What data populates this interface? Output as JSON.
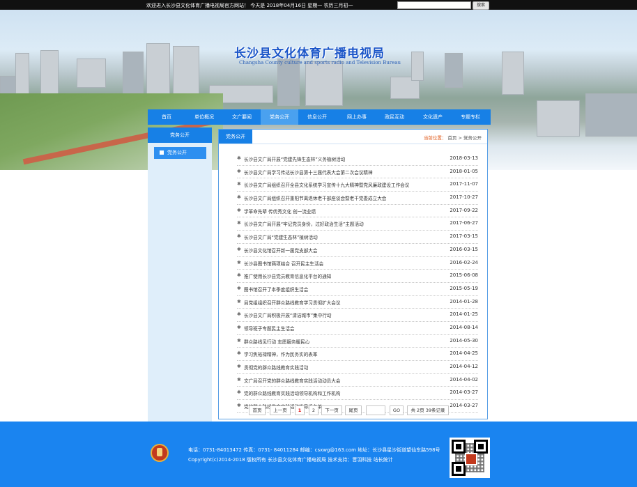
{
  "topbar": {
    "welcome": "欢迎进入长沙县文化体育广播电视局官方网站！ 今天是 2018年04月16日 星期一 农历三月初一",
    "search_value": "",
    "search_button": "搜索"
  },
  "banner": {
    "title": "长沙县文化体育广播电视局",
    "subtitle": "Changsha County culture and sports radio and Television Bureau"
  },
  "nav": [
    {
      "label": "首页"
    },
    {
      "label": "单位概况"
    },
    {
      "label": "文广要闻"
    },
    {
      "label": "党务公开"
    },
    {
      "label": "信息公开"
    },
    {
      "label": "网上办事"
    },
    {
      "label": "政民互动"
    },
    {
      "label": "文化遗产"
    },
    {
      "label": "专题专栏"
    }
  ],
  "sidebar": {
    "heading": "党务公开",
    "items": [
      {
        "label": "党务公开"
      }
    ]
  },
  "main": {
    "tab": "党务公开",
    "crumb_label": "当前位置：",
    "crumb_home": "首页",
    "crumb_sep": ">",
    "crumb_current": "党务公开"
  },
  "articles": [
    {
      "title": "长沙县文广局开展“党建先锋生态林”义务植树活动",
      "date": "2018-03-13"
    },
    {
      "title": "长沙县文广局学习传达长沙县第十三届代表大会第二次会议精神",
      "date": "2018-01-05"
    },
    {
      "title": "长沙县文广局组织召开全县文化系统学习宣传十九大精神暨党风廉政建设工作会议",
      "date": "2017-11-07"
    },
    {
      "title": "长沙县文广局组织召开重阳节离退休老干部座谈会暨老干党委成立大会",
      "date": "2017-10-27"
    },
    {
      "title": "学革命先辈 传优秀文化 创一流业绩",
      "date": "2017-09-22"
    },
    {
      "title": "长沙县文广局开展“牢记党员身份，过好政治生活”主题活动",
      "date": "2017-06-27"
    },
    {
      "title": "长沙县文广局“党建生态林”植树活动",
      "date": "2017-03-15"
    },
    {
      "title": "长沙县文化馆召开新一届党支部大会",
      "date": "2016-03-15"
    },
    {
      "title": "长沙县图书馆两项结合 召开民主生活会",
      "date": "2016-02-24"
    },
    {
      "title": "推广使用长沙县党员教育信息化平台的通知",
      "date": "2015-06-08"
    },
    {
      "title": "图书馆召开了本季度组织生活会",
      "date": "2015-05-19"
    },
    {
      "title": "局党组组织召开群众路线教育学习贯彻扩大会议",
      "date": "2014-01-28"
    },
    {
      "title": "长沙县文广局积极开展“清洁城市”集中行动",
      "date": "2014-01-25"
    },
    {
      "title": "领导班子专题民主生活会",
      "date": "2014-08-14"
    },
    {
      "title": "群众路线见行动 志愿服务暖民心",
      "date": "2014-05-30"
    },
    {
      "title": "学习焦裕禄精神，作为民务实的表率",
      "date": "2014-04-25"
    },
    {
      "title": "贯彻党的群众路线教育实践活动",
      "date": "2014-04-12"
    },
    {
      "title": "文广局召开党的群众路线教育实践活动动员大会",
      "date": "2014-04-02"
    },
    {
      "title": "党的群众路线教育实践活动领导机构和工作机构",
      "date": "2014-03-27"
    },
    {
      "title": "党的群众路线教育实践活动指导组名单",
      "date": "2014-03-27"
    }
  ],
  "pager": {
    "first": "首页",
    "prev": "上一页",
    "pages": [
      "1",
      "2"
    ],
    "next": "下一页",
    "last": "尾页",
    "go_value": "",
    "go": "GO",
    "summary": "共 2页 39条记录"
  },
  "footer": {
    "contact": "电话：0731-84013472 传真：0731- 84011284 邮编：csxwg@163.com 地址：长沙县星沙街道望仙东路598号",
    "copyright": "Copyright(c)2014-2018 版权所有 长沙县文化体育广播电视局   技术支持：晋羽科技  站长统计"
  },
  "colors": {
    "primary": "#1780e6",
    "nav_active": "#4aa1ef",
    "footer": "#1a84f0",
    "sidebar_bg": "#dfeefa",
    "crumb_label": "#e05a1a",
    "title": "#1a55c8"
  }
}
